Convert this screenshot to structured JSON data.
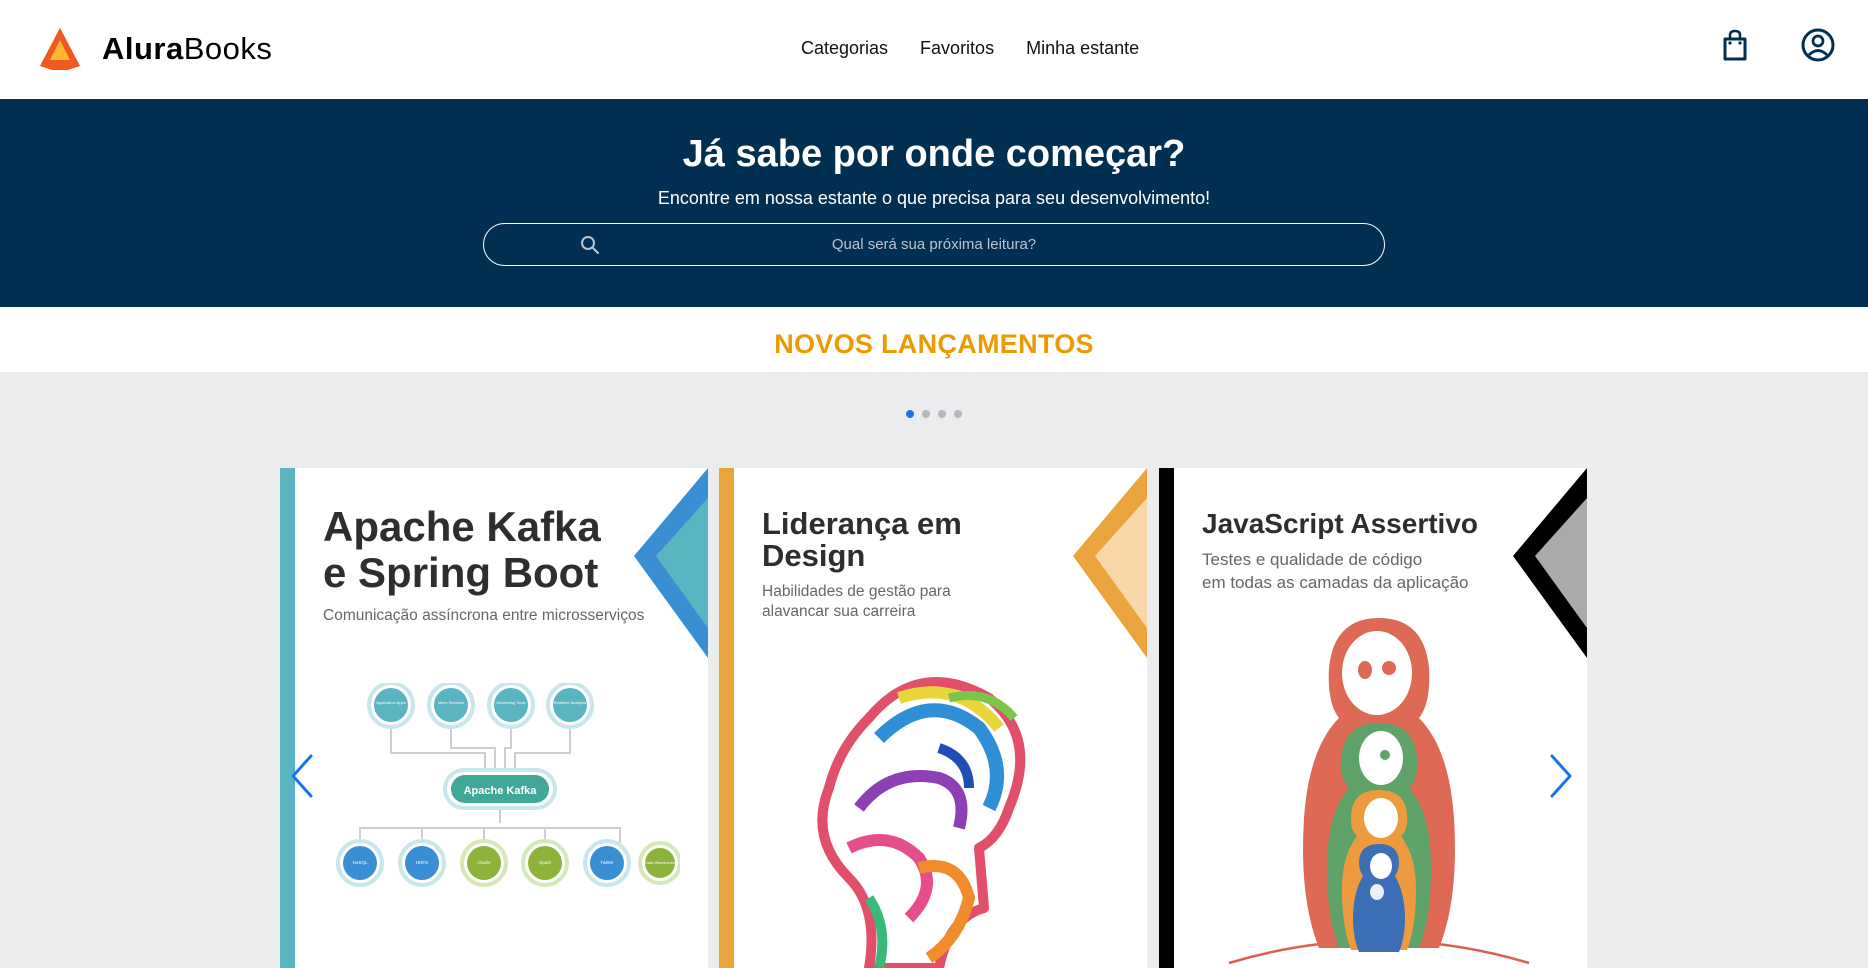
{
  "header": {
    "brand_bold": "Alura",
    "brand_light": "Books",
    "nav": [
      "Categorias",
      "Favoritos",
      "Minha estante"
    ]
  },
  "hero": {
    "title": "Já sabe por onde começar?",
    "subtitle": "Encontre em nossa estante o que precisa para seu desenvolvimento!",
    "search_placeholder": "Qual será sua próxima leitura?"
  },
  "section": {
    "title": "NOVOS LANÇAMENTOS"
  },
  "carousel": {
    "dots": 4,
    "active_dot": 0,
    "books": [
      {
        "title_line1": "Apache Kafka",
        "title_line2": "e Spring Boot",
        "subtitle": "Comunicação assíncrona entre microsserviços",
        "accent": "#5AB4C1",
        "center_label": "Apache Kafka",
        "top_nodes": [
          "Application Apps",
          "Micro Services",
          "Monitoring Tools",
          "Realtime Analytics"
        ],
        "bottom_nodes": [
          "NoSQL",
          "HDFS",
          "Oracle",
          "Spark",
          "Twitter",
          "Data Warehouse"
        ]
      },
      {
        "title_line1": "Liderança em",
        "title_line2": "Design",
        "subtitle_line1": "Habilidades de gestão para",
        "subtitle_line2": "alavancar sua carreira",
        "accent": "#EBA43C"
      },
      {
        "title_line1": "JavaScript Assertivo",
        "subtitle_line1": "Testes e qualidade de código",
        "subtitle_line2": "em todas as camadas da aplicação",
        "accent": "#000000"
      }
    ]
  },
  "colors": {
    "header_bg": "#FFFFFF",
    "hero_bg": "#002F52",
    "section_title": "#EB9B00",
    "page_bg": "#EBECEE",
    "active_dot": "#1875E8",
    "arrow": "#1875E8"
  },
  "icons": {
    "logo": "alurabooks-logo-icon",
    "bag": "shopping-bag-icon",
    "user": "user-circle-icon",
    "search": "search-icon",
    "prev": "chevron-left-icon",
    "next": "chevron-right-icon"
  }
}
